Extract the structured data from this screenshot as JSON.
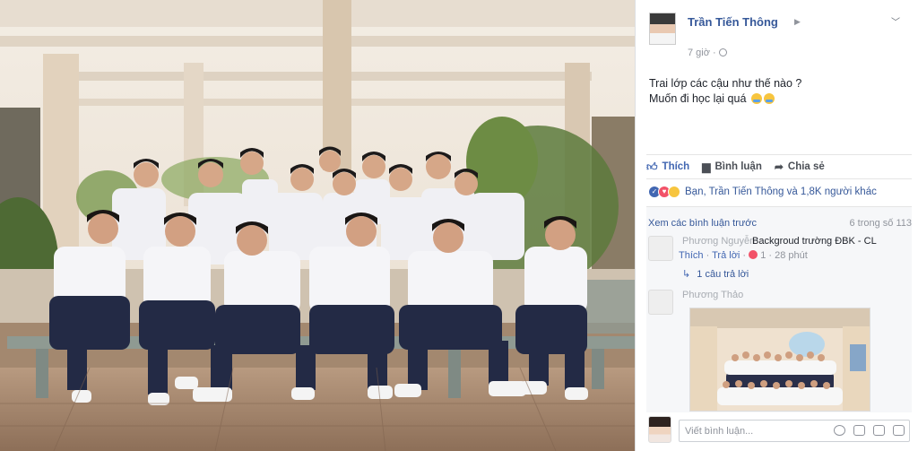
{
  "post": {
    "author": "Trần Tiến Thông",
    "time": "7 giờ",
    "status_line1": "Trai lớp các cậu như thế nào ?",
    "status_line2": "Muốn đi học lại quá"
  },
  "actions": {
    "like": "Thích",
    "comment": "Bình luận",
    "share": "Chia sẻ"
  },
  "reactions": {
    "summary": "Bạn, Trần Tiến Thông và 1,8K người khác"
  },
  "comments": {
    "view_previous": "Xem các bình luận trước",
    "count": "6 trong số 113",
    "items": [
      {
        "author": "Phương Nguyễn",
        "text": "Backgroud trường ĐBK - CL",
        "like_label": "Thích",
        "reply_label": "Trả lời",
        "reaction_count": "1",
        "time": "28 phút",
        "replies_label": "1 câu trả lời"
      },
      {
        "author": "Phương Thảo"
      }
    ],
    "input_placeholder": "Viết bình luận..."
  },
  "colors": {
    "link": "#365899",
    "like_active": "#4267b2",
    "meta": "#90949c",
    "love": "#f25268"
  },
  "icons": [
    "like-icon",
    "comment-icon",
    "share-icon",
    "globe-icon",
    "chevron-down-icon",
    "camera-icon",
    "gif-icon",
    "sticker-icon",
    "emoji-icon"
  ]
}
